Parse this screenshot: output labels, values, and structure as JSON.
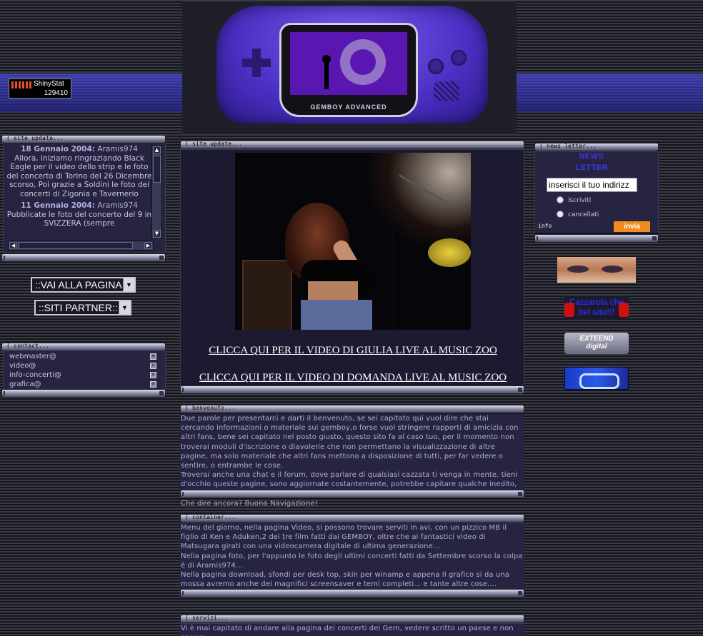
{
  "header": {
    "console_brand": "GEMBOY ADVANCED"
  },
  "counter": {
    "name": "ShinyStat",
    "count": "129410"
  },
  "left_update": {
    "title": "site update...",
    "entries": [
      {
        "date": "18 Gennaio 2004:",
        "author": "Aramis974",
        "text": "Allora, iniziamo ringraziando Black Eagle per il video dello strip e le foto del concerto di Torino del 26 Dicembre scorso, Poi grazie a Soldini le foto dei concerti di Zigonia e Tavernerio"
      },
      {
        "date": "11 Gennaio 2004:",
        "author": "Aramis974",
        "text": "Pubblicate le foto del concerto del 9 in SVIZZERA (sempre"
      }
    ]
  },
  "nav": {
    "vai_alla_pagina": "::VAI ALLA PAGINA::",
    "siti_partner": "::SITI PARTNER::"
  },
  "contact": {
    "title": "contact...",
    "items": [
      "webmaster@",
      "video@",
      "info-concerti@",
      "grafica@"
    ]
  },
  "center_update": {
    "title": "site update...",
    "link1": "CLICCA QUI PER IL VIDEO DI GIULIA LIVE AL MUSIC ZOO",
    "link2": "CLICCA QUI PER IL VIDEO DI DOMANDA LIVE AL MUSIC ZOO"
  },
  "benvenuto": {
    "title": "benvenuto...",
    "p1": "Due parole per presentarci e darti il benvenuto, se sei capitato qui vuol dire che stai cercando informazioni o materiale sui gemboy,o forse vuoi stringere rapporti di amicizia con altri fans, bene sei capitato nel posto giusto, questo sito fa al caso tuo, per il momento non troverai moduli d'iscrizione o diavolerie che non permettano la visualizzazione di altre pagine, ma solo materiale che altri fans mettono a disposizione di tutti, per far vedere o sentire, o entrambe le cose.",
    "p2": "Troverai anche una chat e il forum, dove parlare di qualsiasi cazzata ti venga in mente. tieni d'occhio queste pagine, sono aggiornate costantemente, potrebbe capitare qualche inedito, raduno od altro...",
    "p3": "Che dire ancora? Buona Navigazione!"
  },
  "container": {
    "title": "container...",
    "p1": "Menu del giorno, nella pagina Video, si possono trovare serviti in avi, con un pizzico MB il figlio di Ken e Aduken,2 dei tre film fatti dai GEMBOY, oltre che ai fantastici video di Matsugara girati con una videocamera digitale di ultima generazione...",
    "p2": "Nella pagina foto, per l'appunto le foto degli ultimi concerti fatti da Settembre scorso la colpa è di Aramis974...",
    "p3": "Nella pagina download, sfondi per desk top, skin per winamp e appena Il grafico si da una mossa avremo anche dei magnifici screensaver e temi completi... e tante altre cose...."
  },
  "servizi": {
    "title": "servizi...",
    "p1": "Vi è mai capitato di andare alla pagina dei concerti dei Gem, vedere scritto un paese e non sapere"
  },
  "newsletter": {
    "title": "news letter...",
    "heading1": "NEWS",
    "heading2": "LETTER",
    "input_value": "inserisci il tuo indirizz",
    "option1": "iscriviti",
    "option2": "cancellati",
    "info": "info",
    "submit": "invia"
  },
  "banners": {
    "cazzarola_line1": "Cazzarola che",
    "cazzarola_line2": "bel sito!!!",
    "extreme_line1": "EXTEEND",
    "extreme_line2": "digital"
  },
  "colors": {
    "accent_orange": "#f08c20",
    "band_blue": "#2a2a8a",
    "panel": "#262440",
    "newsletter_blue": "#3a3ae8"
  }
}
